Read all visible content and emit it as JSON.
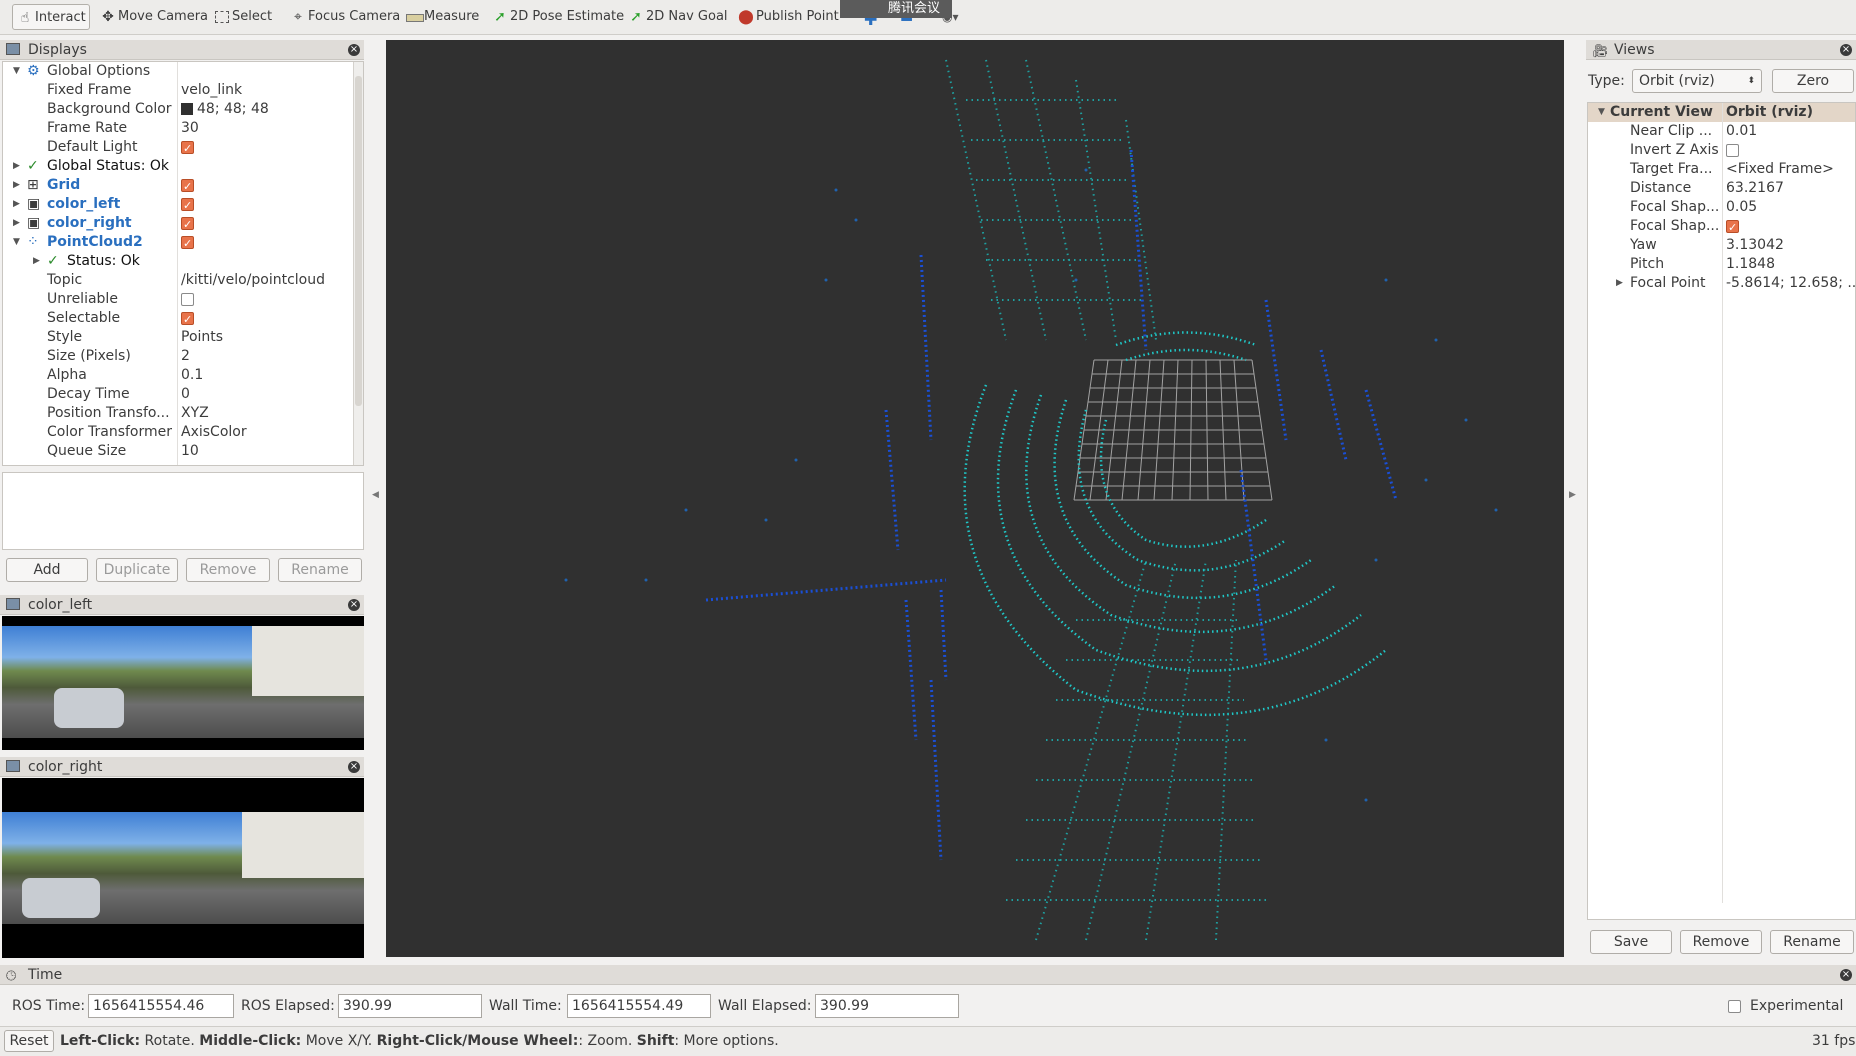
{
  "toolbar": {
    "interact": "Interact",
    "move_camera": "Move Camera",
    "select": "Select",
    "focus_camera": "Focus Camera",
    "measure": "Measure",
    "pose_estimate": "2D Pose Estimate",
    "nav_goal": "2D Nav Goal",
    "publish_point": "Publish Point",
    "meeting_overlay": "腾讯会议"
  },
  "displays": {
    "title": "Displays",
    "rows": {
      "global_options": "Global Options",
      "fixed_frame": {
        "name": "Fixed Frame",
        "value": "velo_link"
      },
      "background_color": {
        "name": "Background Color",
        "value": "48; 48; 48"
      },
      "frame_rate": {
        "name": "Frame Rate",
        "value": "30"
      },
      "default_light": "Default Light",
      "global_status": "Global Status: Ok",
      "grid": "Grid",
      "color_left": "color_left",
      "color_right": "color_right",
      "pointcloud2": "PointCloud2",
      "status": "Status: Ok",
      "topic": {
        "name": "Topic",
        "value": "/kitti/velo/pointcloud"
      },
      "unreliable": "Unreliable",
      "selectable": "Selectable",
      "style": {
        "name": "Style",
        "value": "Points"
      },
      "size": {
        "name": "Size (Pixels)",
        "value": "2"
      },
      "alpha": {
        "name": "Alpha",
        "value": "0.1"
      },
      "decay": {
        "name": "Decay Time",
        "value": "0"
      },
      "position_transformer": {
        "name": "Position Transfo...",
        "value": "XYZ"
      },
      "color_transformer": {
        "name": "Color Transformer",
        "value": "AxisColor"
      },
      "queue_size": {
        "name": "Queue Size",
        "value": "10"
      }
    },
    "buttons": {
      "add": "Add",
      "duplicate": "Duplicate",
      "remove": "Remove",
      "rename": "Rename"
    }
  },
  "camera_left": {
    "title": "color_left"
  },
  "camera_right": {
    "title": "color_right"
  },
  "views": {
    "title": "Views",
    "type_label": "Type:",
    "type_value": "Orbit (rviz)",
    "zero": "Zero",
    "header": {
      "name": "Current View",
      "value": "Orbit (rviz)"
    },
    "rows": [
      {
        "name": "Near Clip ...",
        "value": "0.01"
      },
      {
        "name": "Invert Z Axis",
        "value": ""
      },
      {
        "name": "Target Fra...",
        "value": "<Fixed Frame>"
      },
      {
        "name": "Distance",
        "value": "63.2167"
      },
      {
        "name": "Focal Shap...",
        "value": "0.05"
      },
      {
        "name": "Focal Shap...",
        "value": ""
      },
      {
        "name": "Yaw",
        "value": "3.13042"
      },
      {
        "name": "Pitch",
        "value": "1.1848"
      },
      {
        "name": "Focal Point",
        "value": "-5.8614; 12.658; ..."
      }
    ],
    "buttons": {
      "save": "Save",
      "remove": "Remove",
      "rename": "Rename"
    }
  },
  "time": {
    "title": "Time",
    "ros_time_label": "ROS Time:",
    "ros_time": "1656415554.46",
    "ros_elapsed_label": "ROS Elapsed:",
    "ros_elapsed": "390.99",
    "wall_time_label": "Wall Time:",
    "wall_time": "1656415554.49",
    "wall_elapsed_label": "Wall Elapsed:",
    "wall_elapsed": "390.99",
    "experimental": "Experimental"
  },
  "statusbar": {
    "reset": "Reset",
    "left_click": "Left-Click:",
    "left_action": " Rotate. ",
    "middle_click": "Middle-Click:",
    "middle_action": " Move X/Y. ",
    "right_click": "Right-Click/Mouse Wheel:",
    "right_action": ": Zoom. ",
    "shift": "Shift",
    "shift_action": ": More options.",
    "fps": "31 fps"
  },
  "colors": {
    "viewport_bg": "#303030",
    "point_cyan": "#1fc8c8",
    "point_blue": "#1a4fd6",
    "accent": "#e8734a"
  }
}
